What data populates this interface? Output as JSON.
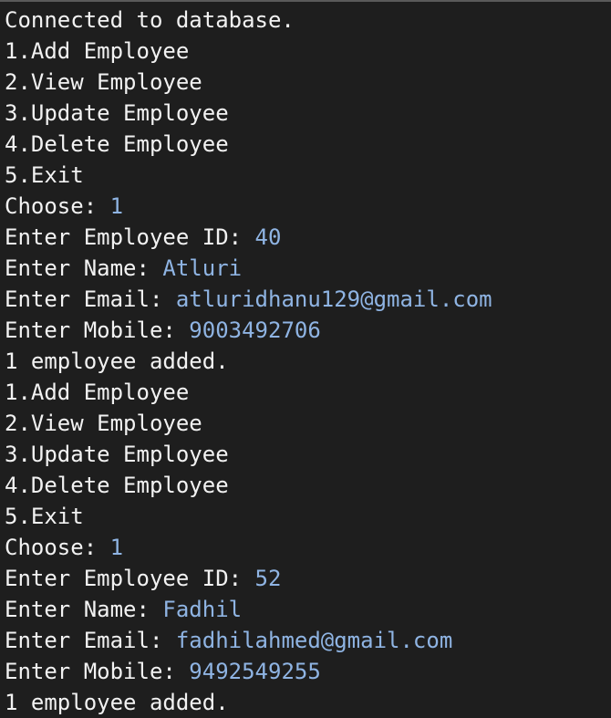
{
  "colors": {
    "background": "#1e1e1e",
    "output_text": "#f2f2f2",
    "user_input": "#8fb4e3"
  },
  "lines": [
    {
      "text": "Connected to database.",
      "input": ""
    },
    {
      "text": "1.Add Employee",
      "input": ""
    },
    {
      "text": "2.View Employee",
      "input": ""
    },
    {
      "text": "3.Update Employee",
      "input": ""
    },
    {
      "text": "4.Delete Employee",
      "input": ""
    },
    {
      "text": "5.Exit",
      "input": ""
    },
    {
      "text": "Choose: ",
      "input": "1"
    },
    {
      "text": "Enter Employee ID: ",
      "input": "40"
    },
    {
      "text": "Enter Name: ",
      "input": "Atluri"
    },
    {
      "text": "Enter Email: ",
      "input": "atluridhanu129@gmail.com"
    },
    {
      "text": "Enter Mobile: ",
      "input": "9003492706"
    },
    {
      "text": "1 employee added.",
      "input": ""
    },
    {
      "text": "1.Add Employee",
      "input": ""
    },
    {
      "text": "2.View Employee",
      "input": ""
    },
    {
      "text": "3.Update Employee",
      "input": ""
    },
    {
      "text": "4.Delete Employee",
      "input": ""
    },
    {
      "text": "5.Exit",
      "input": ""
    },
    {
      "text": "Choose: ",
      "input": "1"
    },
    {
      "text": "Enter Employee ID: ",
      "input": "52"
    },
    {
      "text": "Enter Name: ",
      "input": "Fadhil"
    },
    {
      "text": "Enter Email: ",
      "input": "fadhilahmed@gmail.com"
    },
    {
      "text": "Enter Mobile: ",
      "input": "9492549255"
    },
    {
      "text": "1 employee added.",
      "input": ""
    }
  ]
}
